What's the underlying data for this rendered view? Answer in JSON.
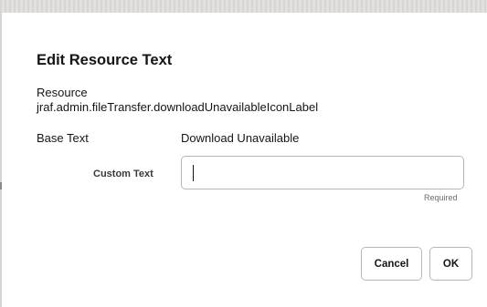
{
  "dialog": {
    "title": "Edit Resource Text",
    "resource_label": "Resource",
    "resource_value": "jraf.admin.fileTransfer.downloadUnavailableIconLabel",
    "base_text_label": "Base Text",
    "base_text_value": "Download Unavailable",
    "custom_text_label": "Custom Text",
    "custom_text_value": "",
    "custom_text_placeholder": "",
    "required_hint": "Required",
    "cancel_label": "Cancel",
    "ok_label": "OK"
  },
  "colors": {
    "text": "#161513",
    "border": "#b9b7b3",
    "muted": "#6f6d69",
    "backdrop": "#e3e1dd"
  }
}
